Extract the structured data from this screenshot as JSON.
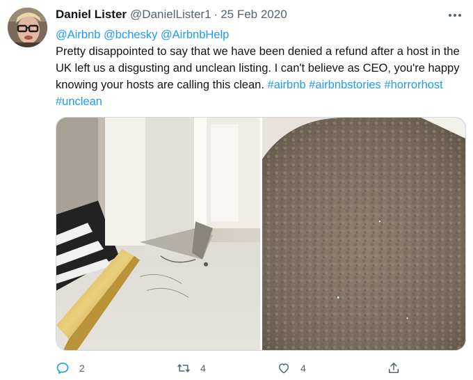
{
  "tweet": {
    "display_name": "Daniel Lister",
    "handle": "@DanielLister1",
    "separator": "·",
    "date": "25 Feb 2020",
    "mentions": {
      "m1": "@Airbnb",
      "m2": "@bchesky",
      "m3": "@AirbnbHelp"
    },
    "body_text": "Pretty disappointed to say that we have been denied a refund after a host in the UK left us a disgusting and unclean listing. I can't believe as CEO, you're happy knowing your hosts are calling this clean.",
    "hashtags": {
      "h1": "#airbnb",
      "h2": "#airbnbstories",
      "h3": "#horrorhost",
      "h4": "#unclean"
    }
  },
  "actions": {
    "reply_count": "2",
    "retweet_count": "4",
    "like_count": "4"
  },
  "icons": {
    "more": "more-icon",
    "reply": "reply-icon",
    "retweet": "retweet-icon",
    "like": "heart-icon",
    "share": "share-icon"
  },
  "colors": {
    "link": "#1d9bf0",
    "text": "#0f1419",
    "muted": "#536471"
  }
}
